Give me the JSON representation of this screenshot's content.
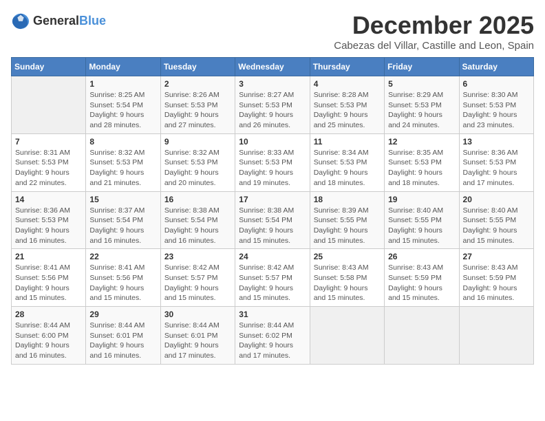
{
  "logo": {
    "general": "General",
    "blue": "Blue"
  },
  "header": {
    "title": "December 2025",
    "subtitle": "Cabezas del Villar, Castille and Leon, Spain"
  },
  "columns": [
    "Sunday",
    "Monday",
    "Tuesday",
    "Wednesday",
    "Thursday",
    "Friday",
    "Saturday"
  ],
  "weeks": [
    [
      {
        "day": "",
        "info": ""
      },
      {
        "day": "1",
        "info": "Sunrise: 8:25 AM\nSunset: 5:54 PM\nDaylight: 9 hours\nand 28 minutes."
      },
      {
        "day": "2",
        "info": "Sunrise: 8:26 AM\nSunset: 5:53 PM\nDaylight: 9 hours\nand 27 minutes."
      },
      {
        "day": "3",
        "info": "Sunrise: 8:27 AM\nSunset: 5:53 PM\nDaylight: 9 hours\nand 26 minutes."
      },
      {
        "day": "4",
        "info": "Sunrise: 8:28 AM\nSunset: 5:53 PM\nDaylight: 9 hours\nand 25 minutes."
      },
      {
        "day": "5",
        "info": "Sunrise: 8:29 AM\nSunset: 5:53 PM\nDaylight: 9 hours\nand 24 minutes."
      },
      {
        "day": "6",
        "info": "Sunrise: 8:30 AM\nSunset: 5:53 PM\nDaylight: 9 hours\nand 23 minutes."
      }
    ],
    [
      {
        "day": "7",
        "info": "Sunrise: 8:31 AM\nSunset: 5:53 PM\nDaylight: 9 hours\nand 22 minutes."
      },
      {
        "day": "8",
        "info": "Sunrise: 8:32 AM\nSunset: 5:53 PM\nDaylight: 9 hours\nand 21 minutes."
      },
      {
        "day": "9",
        "info": "Sunrise: 8:32 AM\nSunset: 5:53 PM\nDaylight: 9 hours\nand 20 minutes."
      },
      {
        "day": "10",
        "info": "Sunrise: 8:33 AM\nSunset: 5:53 PM\nDaylight: 9 hours\nand 19 minutes."
      },
      {
        "day": "11",
        "info": "Sunrise: 8:34 AM\nSunset: 5:53 PM\nDaylight: 9 hours\nand 18 minutes."
      },
      {
        "day": "12",
        "info": "Sunrise: 8:35 AM\nSunset: 5:53 PM\nDaylight: 9 hours\nand 18 minutes."
      },
      {
        "day": "13",
        "info": "Sunrise: 8:36 AM\nSunset: 5:53 PM\nDaylight: 9 hours\nand 17 minutes."
      }
    ],
    [
      {
        "day": "14",
        "info": "Sunrise: 8:36 AM\nSunset: 5:53 PM\nDaylight: 9 hours\nand 16 minutes."
      },
      {
        "day": "15",
        "info": "Sunrise: 8:37 AM\nSunset: 5:54 PM\nDaylight: 9 hours\nand 16 minutes."
      },
      {
        "day": "16",
        "info": "Sunrise: 8:38 AM\nSunset: 5:54 PM\nDaylight: 9 hours\nand 16 minutes."
      },
      {
        "day": "17",
        "info": "Sunrise: 8:38 AM\nSunset: 5:54 PM\nDaylight: 9 hours\nand 15 minutes."
      },
      {
        "day": "18",
        "info": "Sunrise: 8:39 AM\nSunset: 5:55 PM\nDaylight: 9 hours\nand 15 minutes."
      },
      {
        "day": "19",
        "info": "Sunrise: 8:40 AM\nSunset: 5:55 PM\nDaylight: 9 hours\nand 15 minutes."
      },
      {
        "day": "20",
        "info": "Sunrise: 8:40 AM\nSunset: 5:55 PM\nDaylight: 9 hours\nand 15 minutes."
      }
    ],
    [
      {
        "day": "21",
        "info": "Sunrise: 8:41 AM\nSunset: 5:56 PM\nDaylight: 9 hours\nand 15 minutes."
      },
      {
        "day": "22",
        "info": "Sunrise: 8:41 AM\nSunset: 5:56 PM\nDaylight: 9 hours\nand 15 minutes."
      },
      {
        "day": "23",
        "info": "Sunrise: 8:42 AM\nSunset: 5:57 PM\nDaylight: 9 hours\nand 15 minutes."
      },
      {
        "day": "24",
        "info": "Sunrise: 8:42 AM\nSunset: 5:57 PM\nDaylight: 9 hours\nand 15 minutes."
      },
      {
        "day": "25",
        "info": "Sunrise: 8:43 AM\nSunset: 5:58 PM\nDaylight: 9 hours\nand 15 minutes."
      },
      {
        "day": "26",
        "info": "Sunrise: 8:43 AM\nSunset: 5:59 PM\nDaylight: 9 hours\nand 15 minutes."
      },
      {
        "day": "27",
        "info": "Sunrise: 8:43 AM\nSunset: 5:59 PM\nDaylight: 9 hours\nand 16 minutes."
      }
    ],
    [
      {
        "day": "28",
        "info": "Sunrise: 8:44 AM\nSunset: 6:00 PM\nDaylight: 9 hours\nand 16 minutes."
      },
      {
        "day": "29",
        "info": "Sunrise: 8:44 AM\nSunset: 6:01 PM\nDaylight: 9 hours\nand 16 minutes."
      },
      {
        "day": "30",
        "info": "Sunrise: 8:44 AM\nSunset: 6:01 PM\nDaylight: 9 hours\nand 17 minutes."
      },
      {
        "day": "31",
        "info": "Sunrise: 8:44 AM\nSunset: 6:02 PM\nDaylight: 9 hours\nand 17 minutes."
      },
      {
        "day": "",
        "info": ""
      },
      {
        "day": "",
        "info": ""
      },
      {
        "day": "",
        "info": ""
      }
    ]
  ]
}
